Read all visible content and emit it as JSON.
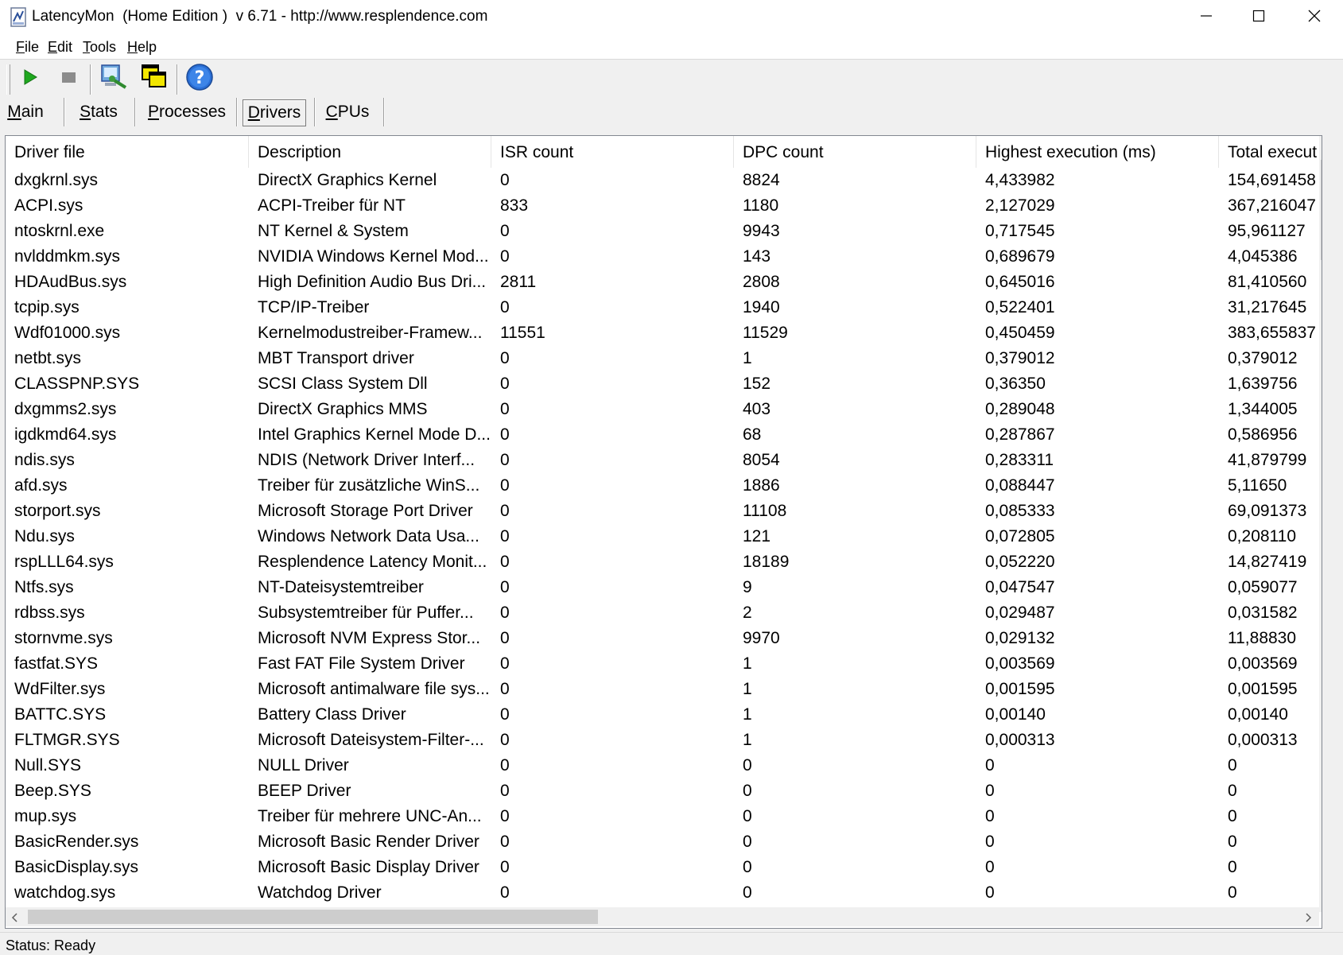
{
  "window": {
    "title": "LatencyMon  (Home Edition )  v 6.71 - http://www.resplendence.com"
  },
  "menu": {
    "items": [
      {
        "mnemonic": "F",
        "rest": "ile"
      },
      {
        "mnemonic": "E",
        "rest": "dit"
      },
      {
        "mnemonic": "T",
        "rest": "ools"
      },
      {
        "mnemonic": "H",
        "rest": "elp"
      }
    ]
  },
  "tabs": [
    {
      "mnemonic": "M",
      "rest": "ain"
    },
    {
      "mnemonic": "S",
      "rest": "tats"
    },
    {
      "mnemonic": "P",
      "rest": "rocesses"
    },
    {
      "mnemonic": "D",
      "rest": "rivers"
    },
    {
      "mnemonic": "C",
      "rest": "PUs"
    }
  ],
  "active_tab": "Drivers",
  "table": {
    "columns": [
      "Driver file",
      "Description",
      "ISR count",
      "DPC count",
      "Highest execution (ms)",
      "Total execut"
    ],
    "rows": [
      [
        "dxgkrnl.sys",
        "DirectX Graphics Kernel",
        "0",
        "8824",
        "4,433982",
        "154,691458"
      ],
      [
        "ACPI.sys",
        "ACPI-Treiber für NT",
        "833",
        "1180",
        "2,127029",
        "367,216047"
      ],
      [
        "ntoskrnl.exe",
        "NT Kernel & System",
        "0",
        "9943",
        "0,717545",
        "95,961127"
      ],
      [
        "nvlddmkm.sys",
        "NVIDIA Windows Kernel Mod...",
        "0",
        "143",
        "0,689679",
        "4,045386"
      ],
      [
        "HDAudBus.sys",
        "High Definition Audio Bus Dri...",
        "2811",
        "2808",
        "0,645016",
        "81,410560"
      ],
      [
        "tcpip.sys",
        "TCP/IP-Treiber",
        "0",
        "1940",
        "0,522401",
        "31,217645"
      ],
      [
        "Wdf01000.sys",
        "Kernelmodustreiber-Framew...",
        "11551",
        "11529",
        "0,450459",
        "383,655837"
      ],
      [
        "netbt.sys",
        "MBT Transport driver",
        "0",
        "1",
        "0,379012",
        "0,379012"
      ],
      [
        "CLASSPNP.SYS",
        "SCSI Class System Dll",
        "0",
        "152",
        "0,36350",
        "1,639756"
      ],
      [
        "dxgmms2.sys",
        "DirectX Graphics MMS",
        "0",
        "403",
        "0,289048",
        "1,344005"
      ],
      [
        "igdkmd64.sys",
        "Intel Graphics Kernel Mode D...",
        "0",
        "68",
        "0,287867",
        "0,586956"
      ],
      [
        "ndis.sys",
        "NDIS (Network Driver Interf...",
        "0",
        "8054",
        "0,283311",
        "41,879799"
      ],
      [
        "afd.sys",
        "Treiber für zusätzliche WinS...",
        "0",
        "1886",
        "0,088447",
        "5,11650"
      ],
      [
        "storport.sys",
        "Microsoft Storage Port Driver",
        "0",
        "11108",
        "0,085333",
        "69,091373"
      ],
      [
        "Ndu.sys",
        "Windows Network Data Usa...",
        "0",
        "121",
        "0,072805",
        "0,208110"
      ],
      [
        "rspLLL64.sys",
        "Resplendence Latency Monit...",
        "0",
        "18189",
        "0,052220",
        "14,827419"
      ],
      [
        "Ntfs.sys",
        "NT-Dateisystemtreiber",
        "0",
        "9",
        "0,047547",
        "0,059077"
      ],
      [
        "rdbss.sys",
        "Subsystemtreiber für Puffer...",
        "0",
        "2",
        "0,029487",
        "0,031582"
      ],
      [
        "stornvme.sys",
        "Microsoft NVM Express Stor...",
        "0",
        "9970",
        "0,029132",
        "11,88830"
      ],
      [
        "fastfat.SYS",
        "Fast FAT File System Driver",
        "0",
        "1",
        "0,003569",
        "0,003569"
      ],
      [
        "WdFilter.sys",
        "Microsoft antimalware file sys...",
        "0",
        "1",
        "0,001595",
        "0,001595"
      ],
      [
        "BATTC.SYS",
        "Battery Class Driver",
        "0",
        "1",
        "0,00140",
        "0,00140"
      ],
      [
        "FLTMGR.SYS",
        "Microsoft Dateisystem-Filter-...",
        "0",
        "1",
        "0,000313",
        "0,000313"
      ],
      [
        "Null.SYS",
        "NULL Driver",
        "0",
        "0",
        "0",
        "0"
      ],
      [
        "Beep.SYS",
        "BEEP Driver",
        "0",
        "0",
        "0",
        "0"
      ],
      [
        "mup.sys",
        "Treiber für mehrere UNC-An...",
        "0",
        "0",
        "0",
        "0"
      ],
      [
        "BasicRender.sys",
        "Microsoft Basic Render Driver",
        "0",
        "0",
        "0",
        "0"
      ],
      [
        "BasicDisplay.sys",
        "Microsoft Basic Display Driver",
        "0",
        "0",
        "0",
        "0"
      ],
      [
        "watchdog.sys",
        "Watchdog Driver",
        "0",
        "0",
        "0",
        "0"
      ]
    ]
  },
  "status": {
    "text": "Status: Ready"
  },
  "colors": {
    "play_green": "#1fa81f",
    "stop_gray": "#808080",
    "help_blue": "#2a6fd6",
    "accent_yellow": "#f2e600"
  }
}
